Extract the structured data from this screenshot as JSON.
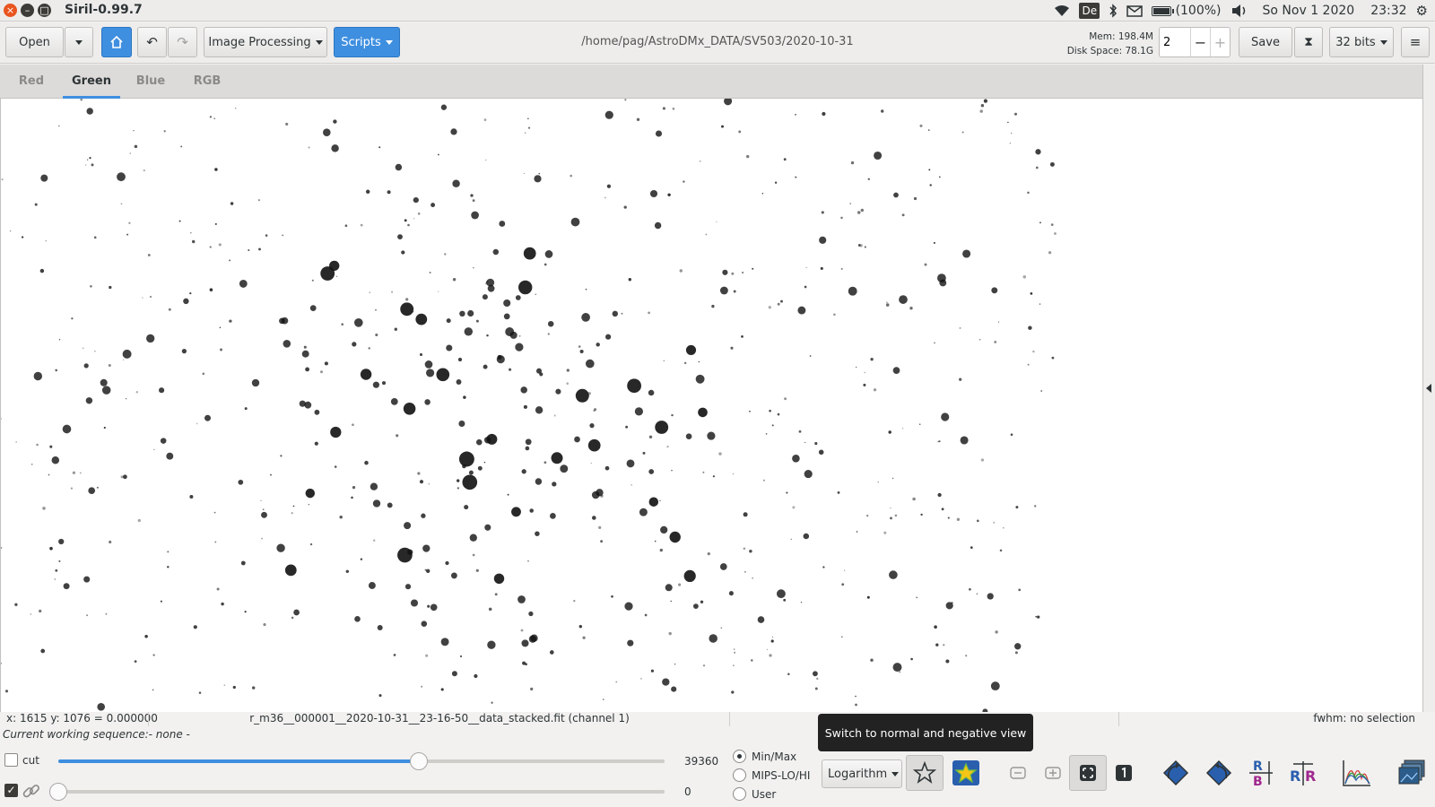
{
  "window": {
    "title": "Siril-0.99.7"
  },
  "tray": {
    "keyboard": "De",
    "battery": "(100%)",
    "date": "So Nov  1 2020",
    "time": "23:32"
  },
  "toolbar": {
    "open_label": "Open",
    "image_processing_label": "Image Processing",
    "scripts_label": "Scripts",
    "path": "/home/pag/AstroDMx_DATA/SV503/2020-10-31",
    "mem": "Mem: 198.4M",
    "disk": "Disk Space: 78.1G",
    "threads": "2",
    "save_label": "Save",
    "bitdepth_label": "32 bits"
  },
  "tabs": [
    {
      "label": "Red"
    },
    {
      "label": "Green"
    },
    {
      "label": "Blue"
    },
    {
      "label": "RGB"
    }
  ],
  "active_tab": "Green",
  "status": {
    "coords": "x: 1615 y: 1076 = 0.000000",
    "filename": "r_m36__000001__2020-10-31__23-16-50__data_stacked.fit (channel 1)",
    "fwhm": "fwhm: no selection",
    "sequence": "Current working sequence:- none -"
  },
  "sliders": {
    "cut_label": "cut",
    "hi_value": "39360",
    "lo_value": "0",
    "hi_fraction": 0.595,
    "lo_fraction": 0.0
  },
  "range_modes": {
    "options": [
      "Min/Max",
      "MIPS-LO/HI",
      "User"
    ],
    "selected": "Min/Max"
  },
  "display_mode": {
    "label": "Logarithm"
  },
  "tooltip": "Switch to normal and negative view",
  "colors": {
    "accent": "#3f8fe0",
    "close": "#e95420"
  }
}
